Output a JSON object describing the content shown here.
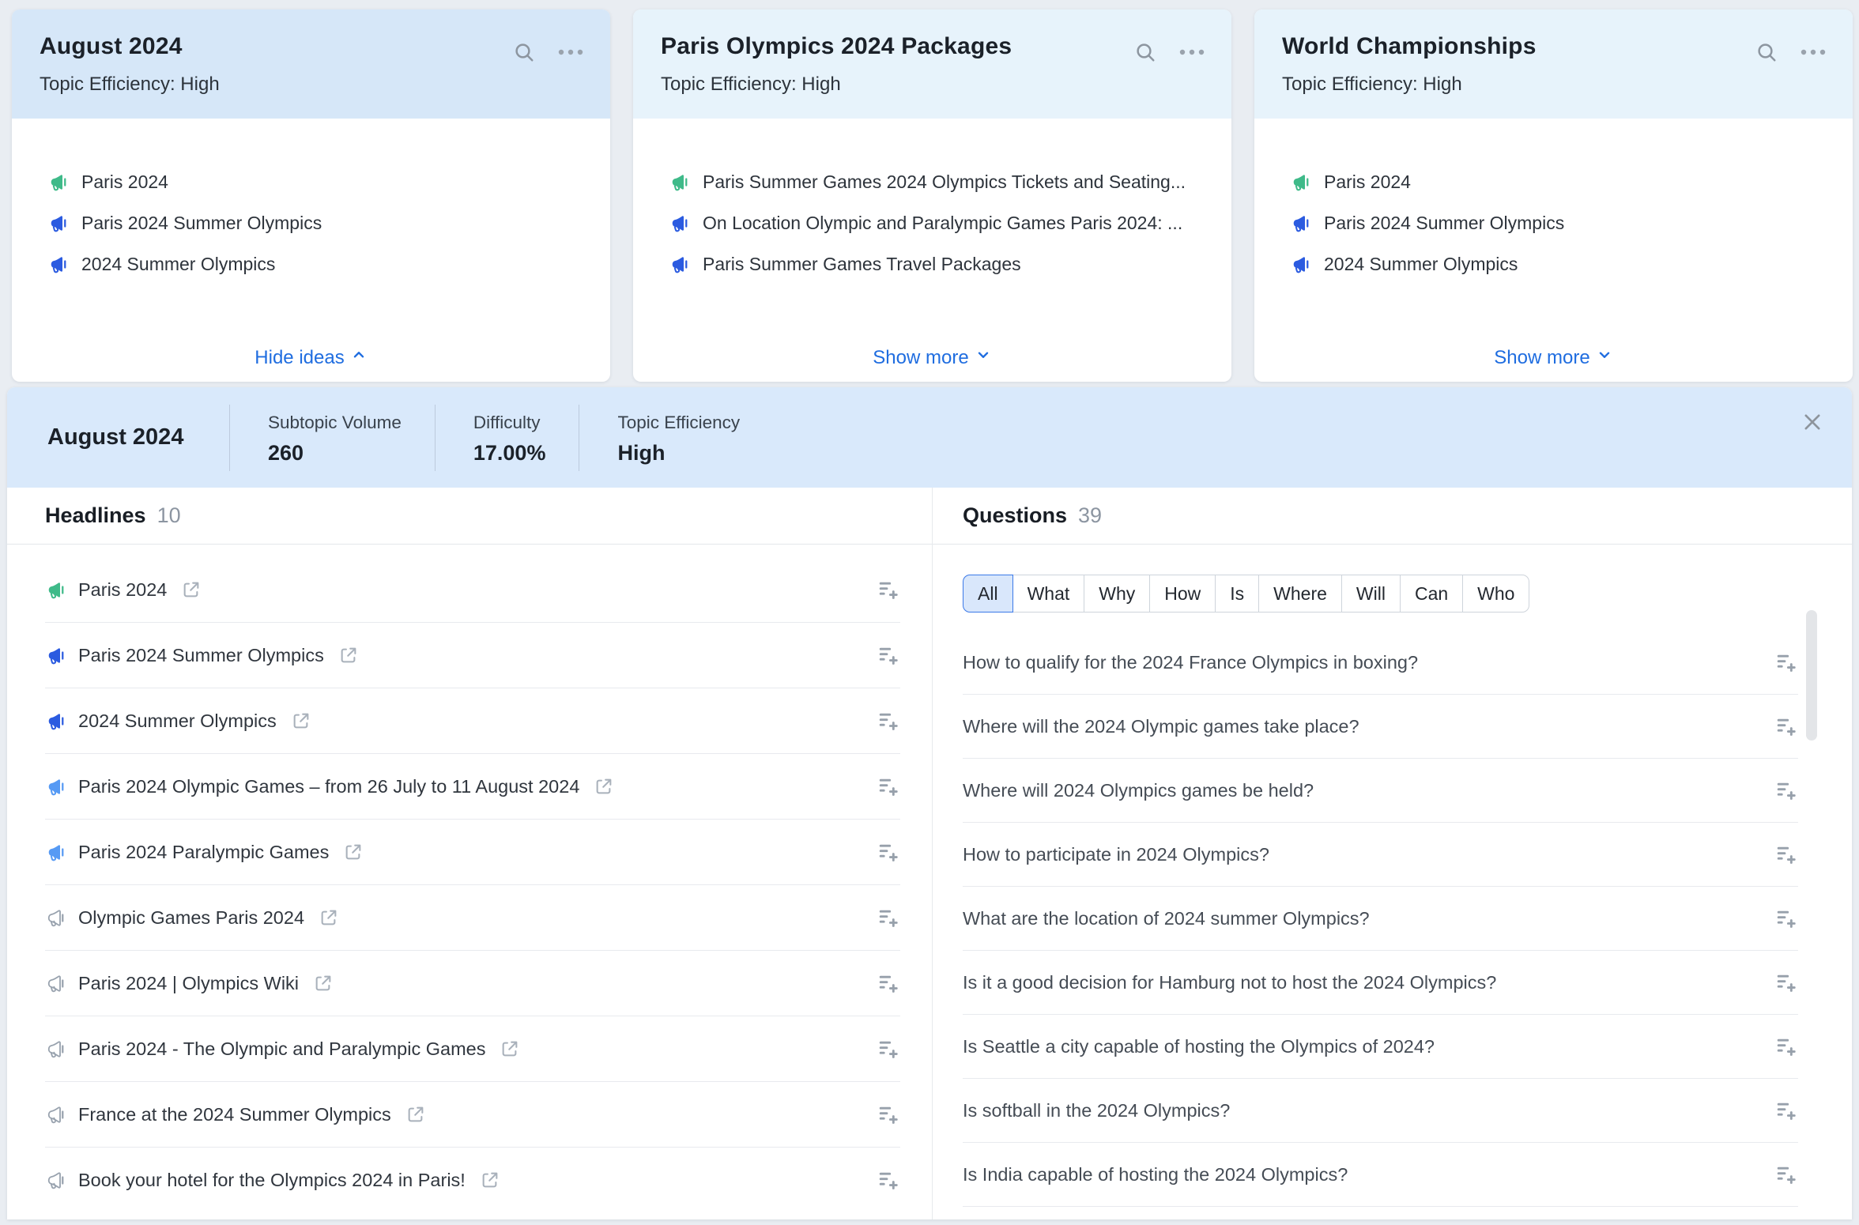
{
  "colors": {
    "accent_link": "#1f6de0",
    "megaphone_green": "#3fba89",
    "megaphone_blue": "#2b5be0",
    "megaphone_lightblue": "#569af4",
    "megaphone_gray": "#98a2ae",
    "selected_header_bg": "#d6e7f8",
    "header_bg": "#e7f3fb",
    "banner_bg": "#d9e9fb",
    "tab_active_border": "#3b79e8",
    "tab_active_bg": "#d9e7fb"
  },
  "cards": [
    {
      "title": "August 2024",
      "subtitle": "Topic Efficiency: High",
      "selected": true,
      "items": [
        {
          "text": "Paris 2024",
          "icon": "green"
        },
        {
          "text": "Paris 2024 Summer Olympics",
          "icon": "blue"
        },
        {
          "text": "2024 Summer Olympics",
          "icon": "blue"
        }
      ],
      "footer": {
        "label": "Hide ideas",
        "chevron": "up"
      }
    },
    {
      "title": "Paris Olympics 2024 Packages",
      "subtitle": "Topic Efficiency: High",
      "selected": false,
      "items": [
        {
          "text": "Paris Summer Games 2024 Olympics Tickets and Seating...",
          "icon": "green"
        },
        {
          "text": "On Location Olympic and Paralympic Games Paris 2024: ...",
          "icon": "blue"
        },
        {
          "text": "Paris Summer Games Travel Packages",
          "icon": "blue"
        }
      ],
      "footer": {
        "label": "Show more",
        "chevron": "down"
      }
    },
    {
      "title": "World Championships",
      "subtitle": "Topic Efficiency: High",
      "selected": false,
      "items": [
        {
          "text": "Paris 2024",
          "icon": "green"
        },
        {
          "text": "Paris 2024 Summer Olympics",
          "icon": "blue"
        },
        {
          "text": "2024 Summer Olympics",
          "icon": "blue"
        }
      ],
      "footer": {
        "label": "Show more",
        "chevron": "down"
      }
    }
  ],
  "detail": {
    "title": "August 2024",
    "stats": [
      {
        "label": "Subtopic Volume",
        "value": "260"
      },
      {
        "label": "Difficulty",
        "value": "17.00%"
      },
      {
        "label": "Topic Efficiency",
        "value": "High"
      }
    ],
    "headlines": {
      "title": "Headlines",
      "count": "10",
      "items": [
        {
          "text": "Paris 2024",
          "icon": "green"
        },
        {
          "text": "Paris 2024 Summer Olympics",
          "icon": "blue"
        },
        {
          "text": "2024 Summer Olympics",
          "icon": "blue"
        },
        {
          "text": "Paris 2024 Olympic Games – from 26 July to 11 August 2024",
          "icon": "lightblue"
        },
        {
          "text": "Paris 2024 Paralympic Games",
          "icon": "lightblue"
        },
        {
          "text": "Olympic Games Paris 2024",
          "icon": "gray"
        },
        {
          "text": "Paris 2024 | Olympics Wiki",
          "icon": "gray"
        },
        {
          "text": "Paris 2024 - The Olympic and Paralympic Games",
          "icon": "gray"
        },
        {
          "text": "France at the 2024 Summer Olympics",
          "icon": "gray"
        },
        {
          "text": "Book your hotel for the Olympics 2024 in Paris!",
          "icon": "gray"
        }
      ]
    },
    "questions": {
      "title": "Questions",
      "count": "39",
      "filters": [
        "All",
        "What",
        "Why",
        "How",
        "Is",
        "Where",
        "Will",
        "Can",
        "Who"
      ],
      "active_filter": "All",
      "items": [
        "How to qualify for the 2024 France Olympics in boxing?",
        "Where will the 2024 Olympic games take place?",
        "Where will 2024 Olympics games be held?",
        "How to participate in 2024 Olympics?",
        "What are the location of 2024 summer Olympics?",
        "Is it a good decision for Hamburg not to host the 2024 Olympics?",
        "Is Seattle a city capable of hosting the Olympics of 2024?",
        "Is softball in the 2024 Olympics?",
        "Is India capable of hosting the 2024 Olympics?"
      ]
    }
  }
}
